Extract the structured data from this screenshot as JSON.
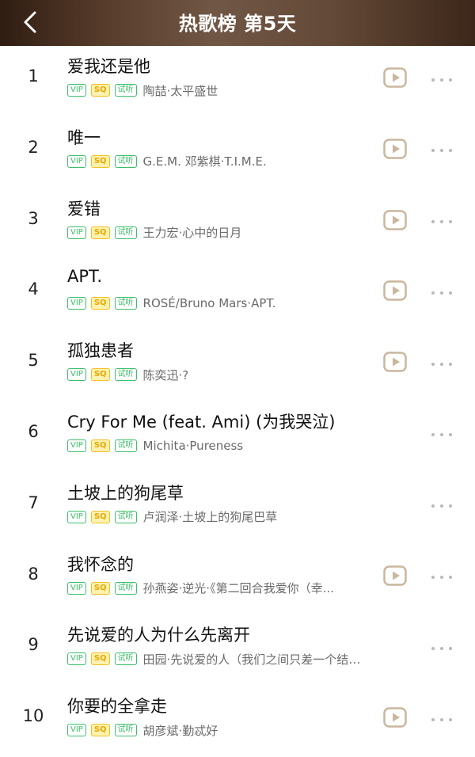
{
  "header": {
    "title": "热歌榜 第5天",
    "back_icon": "chevron-left-icon"
  },
  "badges": {
    "vip": "VIP",
    "sq": "SQ",
    "trial": "试听"
  },
  "colors": {
    "badge_green": "#3cbf6a",
    "badge_sq_bg": "#fff1b0",
    "badge_sq_text": "#e6a800",
    "play_icon_color": "#c9b79e",
    "more_icon_color": "#b9b9b9"
  },
  "songs": [
    {
      "rank": "1",
      "title": "爱我还是他",
      "artist": "陶喆·太平盛世",
      "has_play": true
    },
    {
      "rank": "2",
      "title": "唯一",
      "artist": "G.E.M. 邓紫棋·T.I.M.E.",
      "has_play": true
    },
    {
      "rank": "3",
      "title": "爱错",
      "artist": "王力宏·心中的日月",
      "has_play": true
    },
    {
      "rank": "4",
      "title": "APT.",
      "artist": "ROSÉ/Bruno Mars·APT.",
      "has_play": true
    },
    {
      "rank": "5",
      "title": "孤独患者",
      "artist": "陈奕迅·?",
      "has_play": true
    },
    {
      "rank": "6",
      "title": "Cry For Me (feat. Ami) (为我哭泣)",
      "artist": "Michita·Pureness",
      "has_play": false
    },
    {
      "rank": "7",
      "title": "土坡上的狗尾草",
      "artist": "卢润泽·土坡上的狗尾巴草",
      "has_play": false
    },
    {
      "rank": "8",
      "title": "我怀念的",
      "artist": "孙燕姿·逆光·《第二回合我爱你（幸...",
      "has_play": true
    },
    {
      "rank": "9",
      "title": "先说爱的人为什么先离开",
      "artist": "田园·先说爱的人（我们之间只差一个结果）",
      "has_play": false
    },
    {
      "rank": "10",
      "title": "你要的全拿走",
      "artist": "胡彦斌·勤忒好",
      "has_play": true
    }
  ]
}
